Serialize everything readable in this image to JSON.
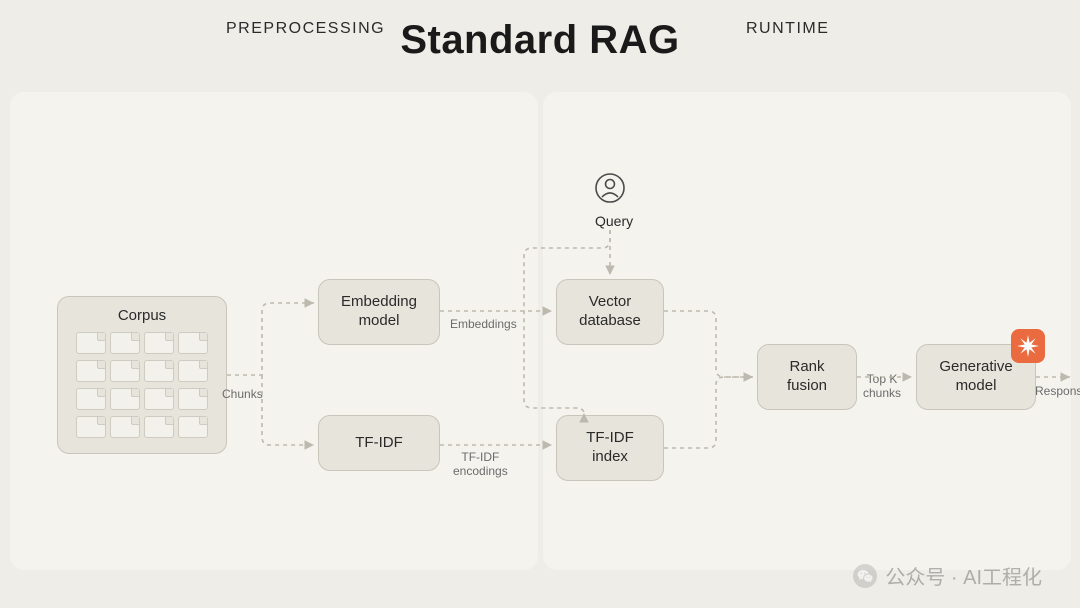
{
  "title": "Standard RAG",
  "sections": {
    "preprocessing": "PREPROCESSING",
    "runtime": "RUNTIME"
  },
  "nodes": {
    "corpus": "Corpus",
    "embedding": "Embedding\nmodel",
    "tfidf": "TF-IDF",
    "vector_db": "Vector\ndatabase",
    "tfidf_index": "TF-IDF\nindex",
    "rank_fusion": "Rank\nfusion",
    "generative": "Generative\nmodel",
    "query": "Query"
  },
  "edges": {
    "chunks": "Chunks",
    "embeddings": "Embeddings",
    "tfidf_encodings": "TF-IDF\nencodings",
    "topk": "Top K\nchunks",
    "response": "Response"
  },
  "icons": {
    "generative_badge": "starburst-icon",
    "user": "user-icon",
    "watermark": "wechat-icon"
  },
  "watermark": "公众号 · AI工程化"
}
